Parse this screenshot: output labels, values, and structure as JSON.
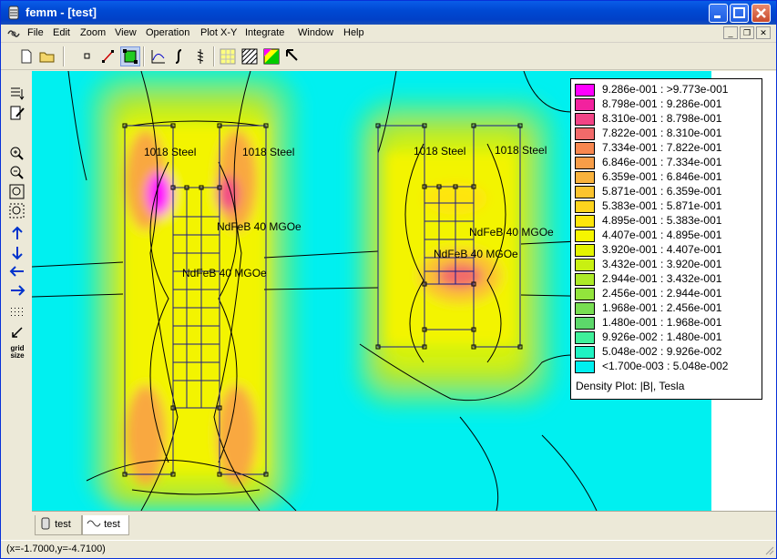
{
  "window": {
    "title": "femm - [test]"
  },
  "menu": [
    "File",
    "Edit",
    "Zoom",
    "View",
    "Operation",
    "Plot X-Y",
    "Integrate",
    "Window",
    "Help"
  ],
  "toolbar": [
    "new-file",
    "open-file",
    "points",
    "contours",
    "areas",
    "plot-xy",
    "line-integral",
    "block-integral",
    "show-mesh",
    "density-plot",
    "vector-plot",
    "select-arrow"
  ],
  "left_toolbar": {
    "grid_size_label": "grid size"
  },
  "labels": {
    "steel1": "1018 Steel",
    "steel2": "1018 Steel",
    "steel3": "1018 Steel",
    "steel4": "1018 Steel",
    "ndfeb1": "NdFeB 40 MGOe",
    "ndfeb2": "NdFeB 40 MGOe",
    "ndfeb3": "NdFeB 40 MGOe",
    "ndfeb4": "NdFeB 40 MGOe"
  },
  "legend": {
    "title": "Density Plot: |B|, Tesla",
    "entries": [
      {
        "label": "9.286e-001 : >9.773e-001",
        "color": "#ff00ff"
      },
      {
        "label": "8.798e-001 : 9.286e-001",
        "color": "#f2229e"
      },
      {
        "label": "8.310e-001 : 8.798e-001",
        "color": "#f24486"
      },
      {
        "label": "7.822e-001 : 8.310e-001",
        "color": "#f26a6a"
      },
      {
        "label": "7.334e-001 : 7.822e-001",
        "color": "#f7874f"
      },
      {
        "label": "6.846e-001 : 7.334e-001",
        "color": "#f79d48"
      },
      {
        "label": "6.359e-001 : 6.846e-001",
        "color": "#f9b23c"
      },
      {
        "label": "5.871e-001 : 6.359e-001",
        "color": "#fbc32e"
      },
      {
        "label": "5.383e-001 : 5.871e-001",
        "color": "#fdd41e"
      },
      {
        "label": "4.895e-001 : 5.383e-001",
        "color": "#fee50a"
      },
      {
        "label": "4.407e-001 : 4.895e-001",
        "color": "#f5f500"
      },
      {
        "label": "3.920e-001 : 4.407e-001",
        "color": "#e4f400"
      },
      {
        "label": "3.432e-001 : 3.920e-001",
        "color": "#c8f012"
      },
      {
        "label": "2.944e-001 : 3.432e-001",
        "color": "#adea28"
      },
      {
        "label": "2.456e-001 : 2.944e-001",
        "color": "#92e43c"
      },
      {
        "label": "1.968e-001 : 2.456e-001",
        "color": "#78de52"
      },
      {
        "label": "1.480e-001 : 1.968e-001",
        "color": "#5cd86a"
      },
      {
        "label": "9.926e-002 : 1.480e-001",
        "color": "#3ff09a"
      },
      {
        "label": "5.048e-002 : 9.926e-002",
        "color": "#1ff2c2"
      },
      {
        "label": "<1.700e-003 : 5.048e-002",
        "color": "#00f0f0"
      }
    ]
  },
  "tabs": [
    "test",
    "test"
  ],
  "status": "(x=-1.7000,y=-4.7100)"
}
